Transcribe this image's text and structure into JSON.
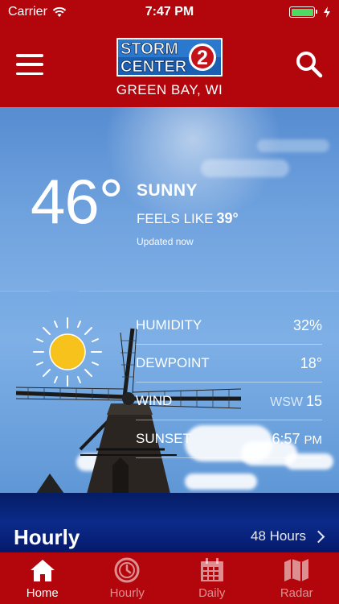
{
  "status_bar": {
    "carrier": "Carrier",
    "time": "7:47 PM",
    "battery_level": 1.0
  },
  "header": {
    "logo_line1": "STORM",
    "logo_line2": "CENTER",
    "logo_number": "2",
    "location": "GREEN BAY, WI"
  },
  "current": {
    "temperature": "46°",
    "condition": "SUNNY",
    "feels_like_label": "FEELS LIKE",
    "feels_like_value": "39°",
    "updated": "Updated now"
  },
  "details": [
    {
      "label": "HUMIDITY",
      "value": "32%"
    },
    {
      "label": "DEWPOINT",
      "value": "18°"
    },
    {
      "label": "WIND",
      "dir": "WSW",
      "value": "15"
    },
    {
      "label": "SUNSET",
      "value": "6:57",
      "suffix": "PM"
    }
  ],
  "hourly": {
    "title": "Hourly",
    "link": "48 Hours"
  },
  "tabs": [
    {
      "label": "Home",
      "icon": "home-icon",
      "active": true
    },
    {
      "label": "Hourly",
      "icon": "clock-icon",
      "active": false
    },
    {
      "label": "Daily",
      "icon": "calendar-icon",
      "active": false
    },
    {
      "label": "Radar",
      "icon": "map-icon",
      "active": false
    }
  ],
  "colors": {
    "brand_red": "#b3060c",
    "hourly_blue": "#0a2b8a",
    "sun_yellow": "#f7c21c"
  }
}
